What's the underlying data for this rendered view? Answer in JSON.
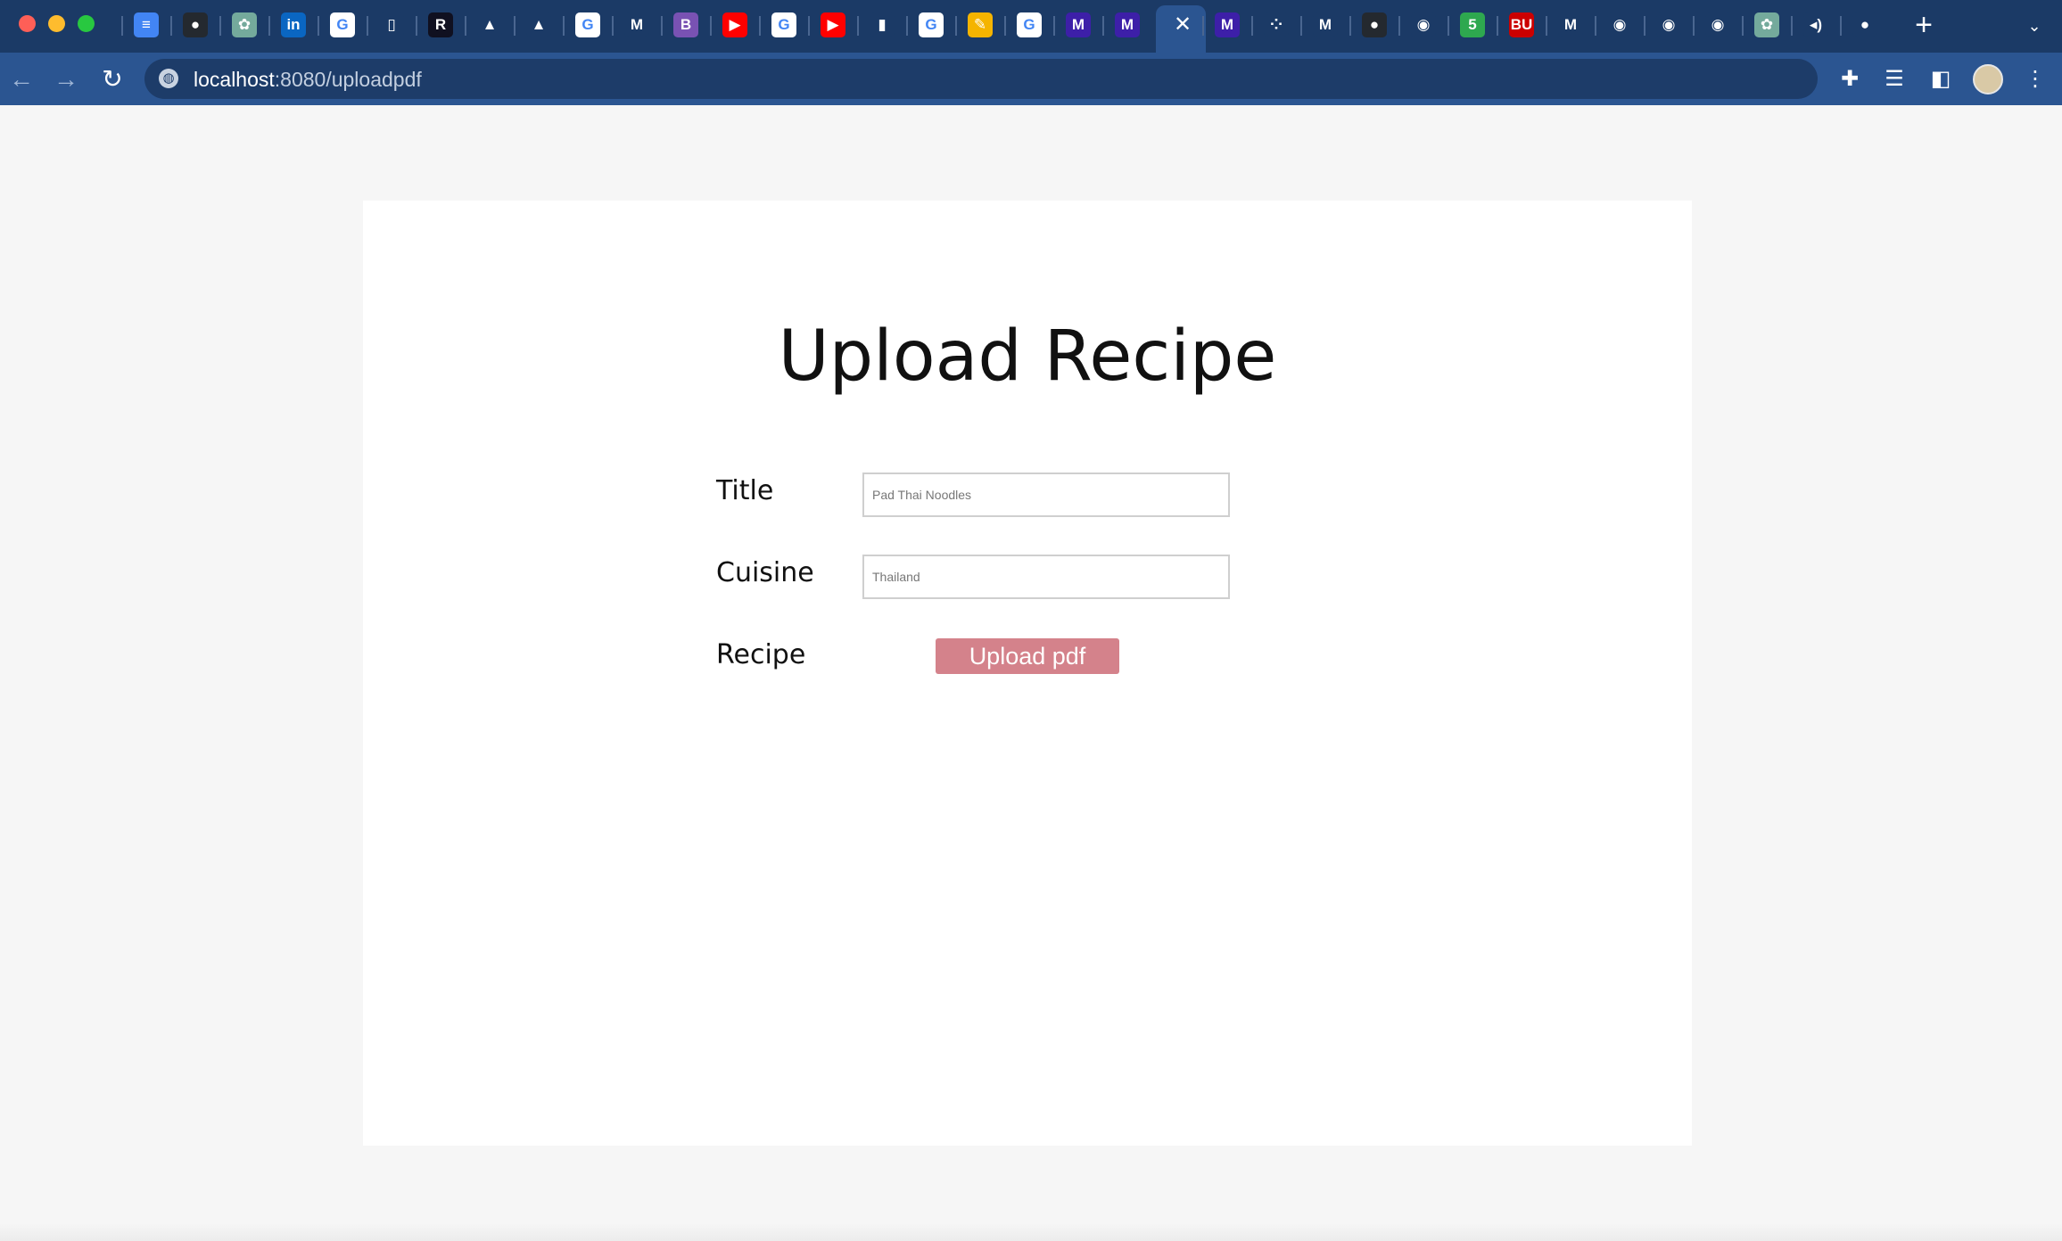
{
  "browser": {
    "url_host": "localhost",
    "url_path": ":8080/uploadpdf",
    "tabs": [
      {
        "icon": "google-docs-icon",
        "glyph": "≡",
        "color": "#4285f4"
      },
      {
        "icon": "github-icon",
        "glyph": "●",
        "color": "#24292f"
      },
      {
        "icon": "chatgpt-icon",
        "glyph": "✿",
        "color": "#74aa9c"
      },
      {
        "icon": "linkedin-icon",
        "glyph": "in",
        "color": "#0a66c2"
      },
      {
        "icon": "google-icon",
        "glyph": "G",
        "color": "#ffffff"
      },
      {
        "icon": "green-doc-icon",
        "glyph": "▯",
        "color": "#1b3a66"
      },
      {
        "icon": "r-app-icon",
        "glyph": "R",
        "color": "#101020"
      },
      {
        "icon": "google-drive-icon",
        "glyph": "▲",
        "color": "#1b3a66"
      },
      {
        "icon": "google-drive-icon",
        "glyph": "▲",
        "color": "#1b3a66"
      },
      {
        "icon": "google-icon",
        "glyph": "G",
        "color": "#ffffff"
      },
      {
        "icon": "gmail-icon",
        "glyph": "M",
        "color": "#1b3a66"
      },
      {
        "icon": "bootstrap-icon",
        "glyph": "B",
        "color": "#7952b3"
      },
      {
        "icon": "youtube-icon",
        "glyph": "▶",
        "color": "#ff0000"
      },
      {
        "icon": "google-icon",
        "glyph": "G",
        "color": "#ffffff"
      },
      {
        "icon": "youtube-icon",
        "glyph": "▶",
        "color": "#ff0000"
      },
      {
        "icon": "analytics-icon",
        "glyph": "▮",
        "color": "#1b3a66"
      },
      {
        "icon": "google-icon",
        "glyph": "G",
        "color": "#ffffff"
      },
      {
        "icon": "notes-icon",
        "glyph": "✎",
        "color": "#f5b400"
      },
      {
        "icon": "google-icon",
        "glyph": "G",
        "color": "#ffffff"
      },
      {
        "icon": "m-app-icon",
        "glyph": "M",
        "color": "#3d1fa8"
      },
      {
        "icon": "m-app-icon",
        "glyph": "M",
        "color": "#3d1fa8"
      }
    ],
    "tabs_after_active": [
      {
        "icon": "m-app-icon",
        "glyph": "M",
        "color": "#3d1fa8"
      },
      {
        "icon": "apps-grid-icon",
        "glyph": "⁘",
        "color": "#1b3a66"
      },
      {
        "icon": "gmail-icon",
        "glyph": "M",
        "color": "#1b3a66"
      },
      {
        "icon": "github-icon",
        "glyph": "●",
        "color": "#24292f"
      },
      {
        "icon": "chrome-icon",
        "glyph": "◉",
        "color": "#1b3a66"
      },
      {
        "icon": "chat-badge-icon",
        "glyph": "5",
        "color": "#2ea84f"
      },
      {
        "icon": "bu-icon",
        "glyph": "BU",
        "color": "#cc0000"
      },
      {
        "icon": "gmail-icon",
        "glyph": "M",
        "color": "#1b3a66"
      },
      {
        "icon": "chrome-icon",
        "glyph": "◉",
        "color": "#1b3a66"
      },
      {
        "icon": "chrome-icon",
        "glyph": "◉",
        "color": "#1b3a66"
      },
      {
        "icon": "chrome-icon",
        "glyph": "◉",
        "color": "#1b3a66"
      },
      {
        "icon": "chatgpt-icon",
        "glyph": "✿",
        "color": "#74aa9c"
      },
      {
        "icon": "audio-icon",
        "glyph": "◂)",
        "color": "#1b3a66"
      },
      {
        "icon": "purple-orb-icon",
        "glyph": "●",
        "color": "#1b3a66"
      }
    ]
  },
  "page": {
    "title": "Upload Recipe",
    "fields": {
      "title_label": "Title",
      "title_placeholder": "Pad Thai Noodles",
      "cuisine_label": "Cuisine",
      "cuisine_placeholder": "Thailand",
      "recipe_label": "Recipe"
    },
    "upload_button_label": "Upload pdf"
  },
  "colors": {
    "chrome_dark": "#1b3a66",
    "chrome_toolbar": "#2b5591",
    "upload_button": "#d4828b",
    "page_background": "#f6f6f6"
  }
}
